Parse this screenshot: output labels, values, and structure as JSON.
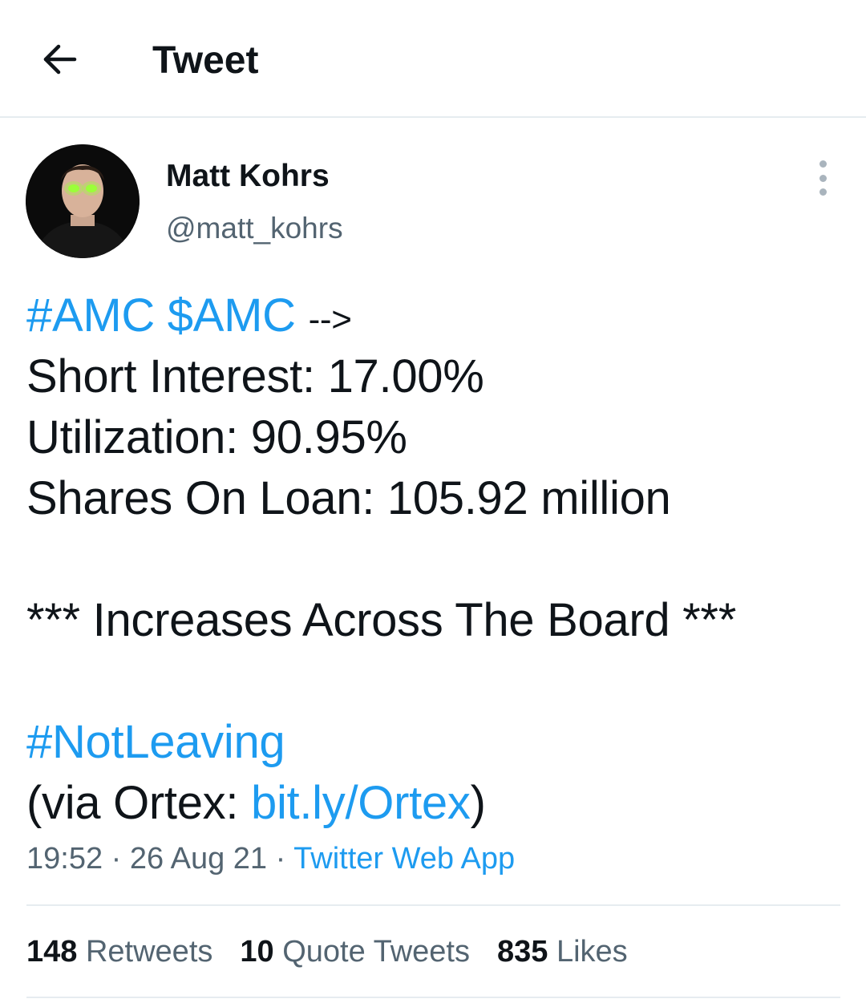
{
  "header": {
    "back_icon": "arrow-left-icon",
    "title": "Tweet"
  },
  "author": {
    "name": "Matt Kohrs",
    "handle": "@matt_kohrs",
    "more_icon": "more-vertical-icon"
  },
  "tweet": {
    "line1": {
      "hashtag": "#AMC",
      "cashtag": "$AMC",
      "arrow": "-->"
    },
    "line2": "Short Interest: 17.00%",
    "line3": "Utilization: 90.95%",
    "line4": "Shares On Loan: 105.92 million",
    "line5": "*** Increases Across The Board ***",
    "line6_hashtag": "#NotLeaving",
    "line7": {
      "prefix": "(via Ortex: ",
      "link": "bit.ly/Ortex",
      "suffix": ")"
    }
  },
  "meta": {
    "time": "19:52",
    "separator": "·",
    "date": "26 Aug 21",
    "source": "Twitter Web App"
  },
  "stats": [
    {
      "count": "148",
      "label": "Retweets"
    },
    {
      "count": "10",
      "label": "Quote Tweets"
    },
    {
      "count": "835",
      "label": "Likes"
    }
  ],
  "colors": {
    "link": "#1d9bf0",
    "secondary": "#536471",
    "text": "#0f1419",
    "divider": "#e6ecf0"
  }
}
